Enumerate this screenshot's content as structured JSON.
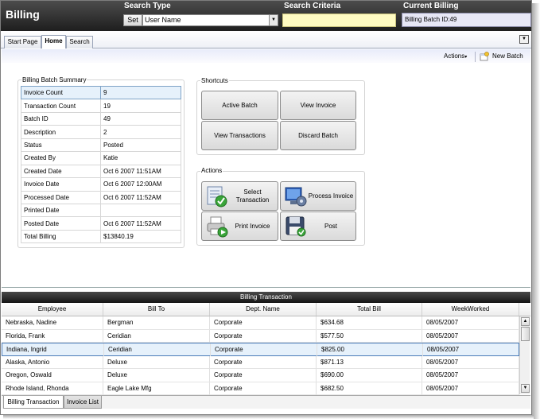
{
  "header": {
    "app_title": "Billing",
    "search_type_label": "Search Type",
    "set_button": "Set",
    "search_type_value": "User Name",
    "search_criteria_label": "Search Criteria",
    "search_criteria_value": "",
    "current_billing_label": "Current Billing",
    "current_billing_value": "Billing Batch ID:49"
  },
  "tabs": [
    "Start Page",
    "Home",
    "Search"
  ],
  "active_tab": "Home",
  "toolbar": {
    "actions_label": "Actions",
    "new_batch_label": "New Batch"
  },
  "summary": {
    "title": "Billing Batch Summary",
    "rows": [
      {
        "key": "Invoice Count",
        "value": "9"
      },
      {
        "key": "Transaction Count",
        "value": "19"
      },
      {
        "key": "Batch ID",
        "value": "49"
      },
      {
        "key": "Description",
        "value": "2"
      },
      {
        "key": "Status",
        "value": "Posted"
      },
      {
        "key": "Created By",
        "value": "Katie"
      },
      {
        "key": "Created Date",
        "value": "Oct  6 2007 11:51AM"
      },
      {
        "key": "Invoice Date",
        "value": "Oct  6 2007 12:00AM"
      },
      {
        "key": "Processed Date",
        "value": "Oct  6 2007 11:52AM"
      },
      {
        "key": "Printed Date",
        "value": ""
      },
      {
        "key": "Posted Date",
        "value": "Oct  6 2007 11:52AM"
      },
      {
        "key": "Total Billing",
        "value": "$13840.19"
      }
    ]
  },
  "shortcuts": {
    "title": "Shortcuts",
    "buttons": [
      "Active Batch",
      "View Invoice",
      "View Transactions",
      "Discard Batch"
    ]
  },
  "actions": {
    "title": "Actions",
    "buttons": [
      {
        "label_line1": "Select",
        "label_line2": "Transaction",
        "icon": "select-transaction-icon"
      },
      {
        "label_line1": "Process Invoice",
        "label_line2": "",
        "icon": "process-invoice-icon"
      },
      {
        "label_line1": "Print Invoice",
        "label_line2": "",
        "icon": "print-invoice-icon"
      },
      {
        "label_line1": "Post",
        "label_line2": "",
        "icon": "post-icon"
      }
    ]
  },
  "grid": {
    "title": "Billing Transaction",
    "columns": [
      "Employee",
      "Bill To",
      "Dept. Name",
      "Total Bill",
      "WeekWorked"
    ],
    "rows": [
      [
        "Nebraska, Nadine",
        "Bergman",
        "Corporate",
        "$634.68",
        "08/05/2007"
      ],
      [
        "Florida, Frank",
        "Ceridian",
        "Corporate",
        "$577.50",
        "08/05/2007"
      ],
      [
        "Indiana, Ingrid",
        "Ceridian",
        "Corporate",
        "$825.00",
        "08/05/2007"
      ],
      [
        "Alaska, Antonio",
        "Deluxe",
        "Corporate",
        "$871.13",
        "08/05/2007"
      ],
      [
        "Oregon, Oswald",
        "Deluxe",
        "Corporate",
        "$690.00",
        "08/05/2007"
      ],
      [
        "Rhode Island, Rhonda",
        "Eagle Lake Mfg",
        "Corporate",
        "$682.50",
        "08/05/2007"
      ]
    ],
    "selected_row": 2
  },
  "bottom_tabs": [
    "Billing Transaction",
    "Invoice List"
  ],
  "colors": {
    "header_dark": "#1e1e1e",
    "search_criteria_bg": "#fffbc2",
    "selection": "#e6f1fb"
  }
}
